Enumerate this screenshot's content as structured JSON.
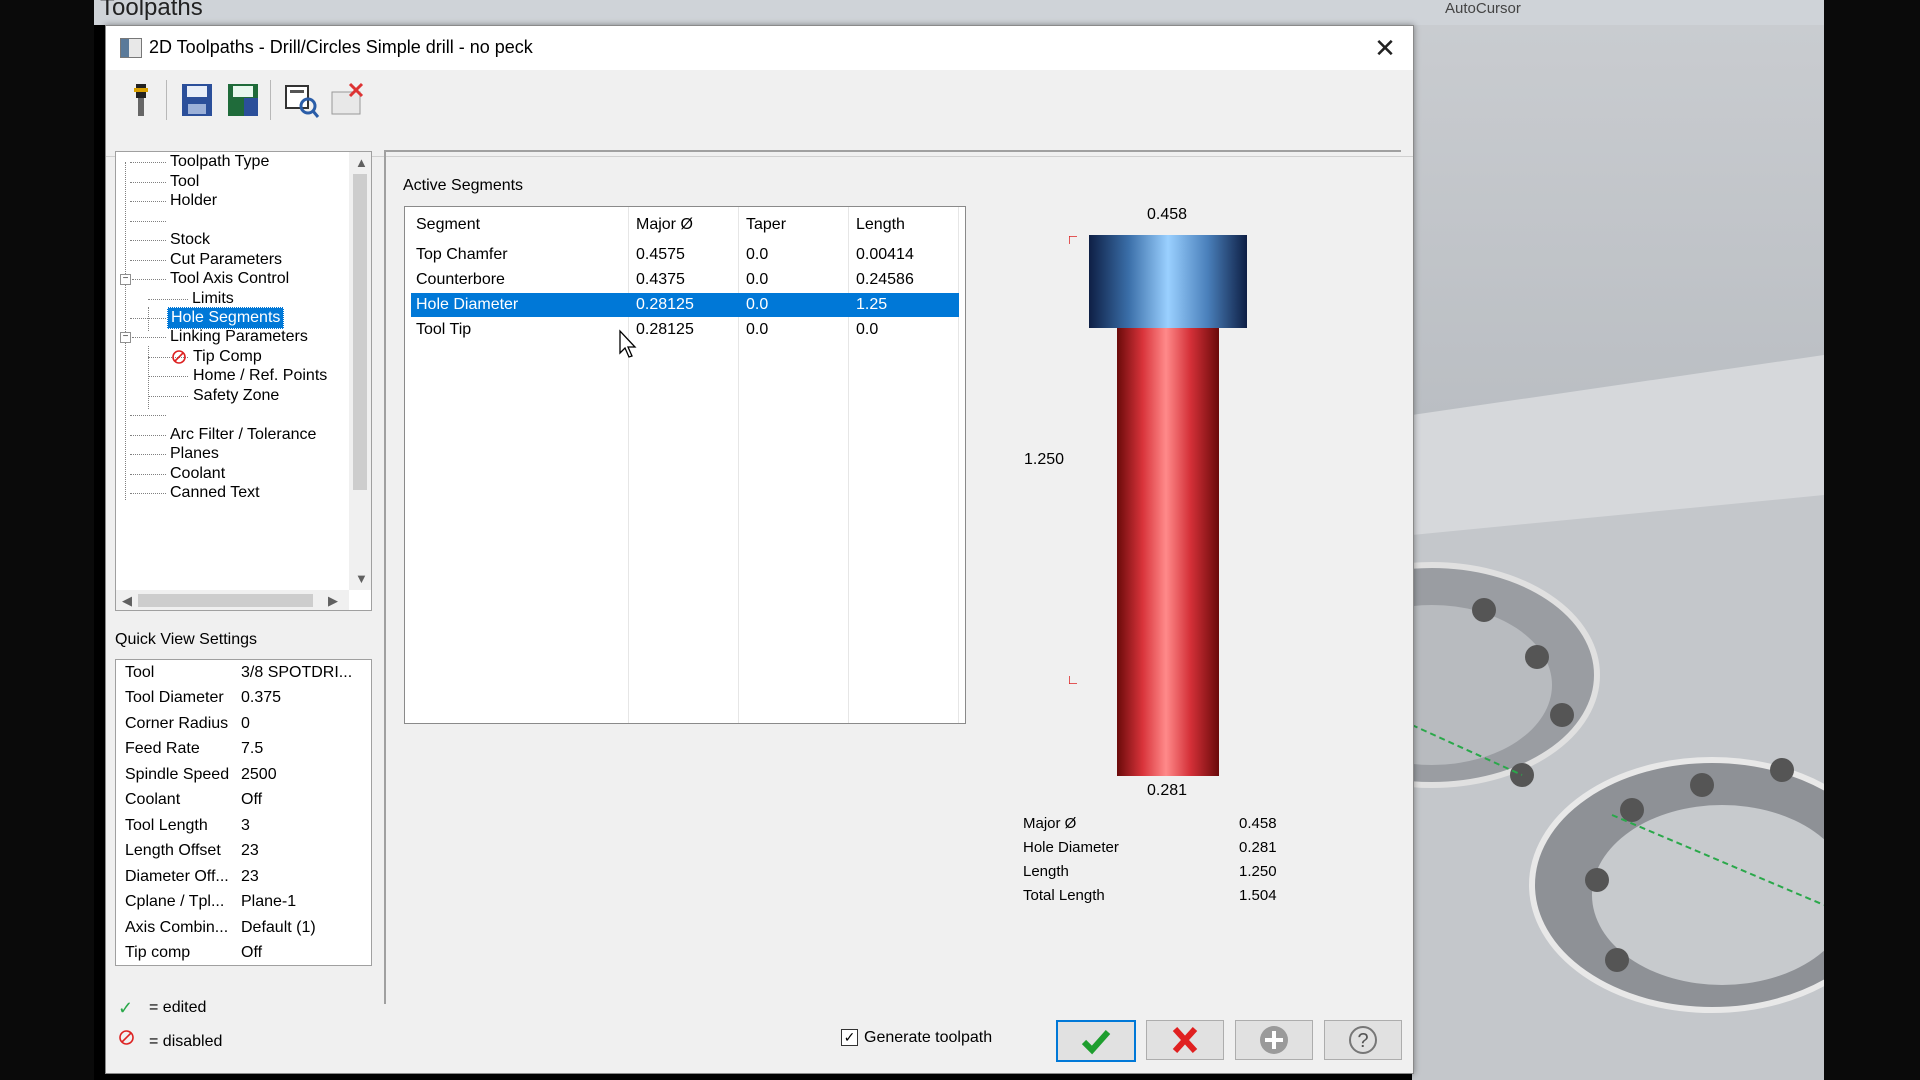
{
  "background": {
    "panel_title": "Toolpaths",
    "toolbar_text": "AutoCursor"
  },
  "dialog": {
    "title": "2D Toolpaths - Drill/Circles Simple drill - no peck",
    "close_icon": "close-icon"
  },
  "toolbar": {
    "buttons": [
      {
        "name": "tool-icon"
      },
      {
        "name": "save-icon"
      },
      {
        "name": "save-as-icon"
      },
      {
        "name": "view-icon"
      },
      {
        "name": "delete-icon"
      }
    ]
  },
  "tree": {
    "items": [
      {
        "label": "Toolpath Type"
      },
      {
        "label": "Tool"
      },
      {
        "label": "Holder"
      },
      {
        "label": ""
      },
      {
        "label": "Stock"
      },
      {
        "label": "Cut Parameters"
      },
      {
        "label": "Tool Axis Control"
      },
      {
        "label": "Limits"
      },
      {
        "label": "Hole Segments"
      },
      {
        "label": "Linking Parameters"
      },
      {
        "label": "Tip Comp"
      },
      {
        "label": "Home / Ref. Points"
      },
      {
        "label": "Safety Zone"
      },
      {
        "label": ""
      },
      {
        "label": "Arc Filter / Tolerance"
      },
      {
        "label": "Planes"
      },
      {
        "label": "Coolant"
      },
      {
        "label": "Canned Text"
      }
    ],
    "selected": "Hole Segments"
  },
  "quick_view": {
    "label": "Quick View Settings",
    "rows": [
      {
        "key": "Tool",
        "value": "3/8 SPOTDRI..."
      },
      {
        "key": "Tool Diameter",
        "value": "0.375"
      },
      {
        "key": "Corner Radius",
        "value": "0"
      },
      {
        "key": "Feed Rate",
        "value": "7.5"
      },
      {
        "key": "Spindle Speed",
        "value": "2500"
      },
      {
        "key": "Coolant",
        "value": "Off"
      },
      {
        "key": "Tool Length",
        "value": "3"
      },
      {
        "key": "Length Offset",
        "value": "23"
      },
      {
        "key": "Diameter Off...",
        "value": "23"
      },
      {
        "key": "Cplane / Tpl...",
        "value": "Plane-1"
      },
      {
        "key": "Axis Combin...",
        "value": "Default (1)"
      },
      {
        "key": "Tip comp",
        "value": "Off"
      }
    ]
  },
  "legend": {
    "edited": "= edited",
    "disabled": "= disabled"
  },
  "segments": {
    "label": "Active Segments",
    "headers": [
      "Segment",
      "Major Ø",
      "Taper",
      "Length"
    ],
    "rows": [
      {
        "segment": "Top Chamfer",
        "major": "0.4575",
        "taper": "0.0",
        "length": "0.00414"
      },
      {
        "segment": "Counterbore",
        "major": "0.4375",
        "taper": "0.0",
        "length": "0.24586"
      },
      {
        "segment": "Hole Diameter",
        "major": "0.28125",
        "taper": "0.0",
        "length": "1.25"
      },
      {
        "segment": "Tool Tip",
        "major": "0.28125",
        "taper": "0.0",
        "length": "0.0"
      }
    ],
    "selected_row": 2
  },
  "preview": {
    "top_dim": "0.458",
    "side_dim": "1.250",
    "bottom_dim": "0.281",
    "stats": [
      {
        "key": "Major Ø",
        "value": "0.458"
      },
      {
        "key": "Hole Diameter",
        "value": "0.281"
      },
      {
        "key": "Length",
        "value": "1.250"
      },
      {
        "key": "Total Length",
        "value": "1.504"
      }
    ]
  },
  "footer": {
    "generate_label": "Generate toolpath",
    "generate_checked": true,
    "ok_icon": "checkmark-icon",
    "cancel_icon": "x-icon",
    "apply_icon": "plus-icon",
    "help_icon": "help-icon"
  },
  "colors": {
    "selection": "#0078d7",
    "counterbore": "#4a80bb",
    "hole": "#d8333a"
  }
}
